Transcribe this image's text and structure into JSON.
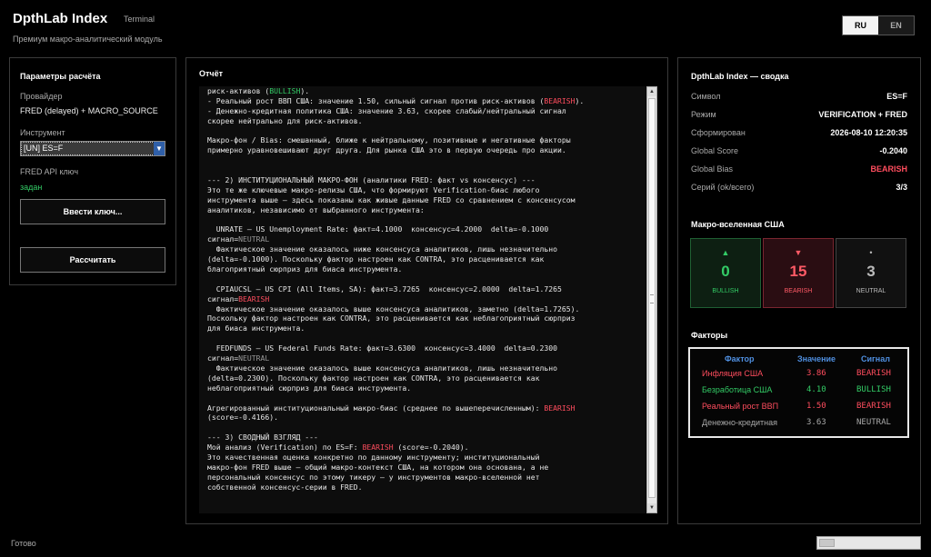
{
  "header": {
    "title": "DpthLab Index",
    "terminal": "Terminal",
    "subtitle": "Премиум макро-аналитический модуль"
  },
  "lang": {
    "ru": "RU",
    "en": "EN",
    "active": "RU"
  },
  "params": {
    "title": "Параметры расчёта",
    "provider_label": "Провайдер",
    "provider_value": "FRED (delayed) + MACRO_SOURCE",
    "instrument_label": "Инструмент",
    "instrument_value": "[UN] ES=F",
    "apikey_label": "FRED API ключ",
    "apikey_status": "задан",
    "enter_key_button": "Ввести ключ...",
    "calculate_button": "Рассчитать"
  },
  "report": {
    "title": "Отчёт",
    "lines": [
      [
        [
          "риск-активов (",
          ""
        ],
        [
          "BULLISH",
          "bull"
        ],
        [
          ").",
          ""
        ]
      ],
      [
        [
          "- Реальный рост ВВП США: значение 1.50, сильный сигнал против риск-активов (",
          ""
        ],
        [
          "BEARISH",
          "bear"
        ],
        [
          ").",
          ""
        ]
      ],
      [
        [
          "- Денежно-кредитная политика США: значение 3.63, скорее слабый/нейтральный сигнал",
          ""
        ]
      ],
      [
        [
          "скорее нейтрально для риск-активов.",
          ""
        ]
      ],
      [
        [
          "",
          ""
        ]
      ],
      [
        [
          "Макро-фон / Bias: смешанный, ближе к нейтральному, позитивные и негативные факторы",
          ""
        ]
      ],
      [
        [
          "примерно уравновешивают друг друга. Для рынка США это в первую очередь про акции.",
          ""
        ]
      ],
      [
        [
          "",
          ""
        ]
      ],
      [
        [
          "",
          ""
        ]
      ],
      [
        [
          "--- 2) ИНСТИТУЦИОНАЛЬНЫЙ МАКРО-ФОН (аналитики FRED: факт vs консенсус) ---",
          ""
        ]
      ],
      [
        [
          "Это те же ключевые макро-релизы США, что формируют Verification-биас любого",
          ""
        ]
      ],
      [
        [
          "инструмента выше — здесь показаны как живые данные FRED со сравнением с консенсусом",
          ""
        ]
      ],
      [
        [
          "аналитиков, независимо от выбранного инструмента:",
          ""
        ]
      ],
      [
        [
          "",
          ""
        ]
      ],
      [
        [
          "  UNRATE — US Unemployment Rate: факт=4.1000  консенсус=4.2000  delta=-0.1000",
          ""
        ]
      ],
      [
        [
          "сигнал=",
          ""
        ],
        [
          "NEUTRAL",
          "neu"
        ]
      ],
      [
        [
          "  Фактическое значение оказалось ниже консенсуса аналитиков, лишь незначительно",
          ""
        ]
      ],
      [
        [
          "(delta=-0.1000). Поскольку фактор настроен как CONTRA, это расценивается как",
          ""
        ]
      ],
      [
        [
          "благоприятный сюрприз для биаса инструмента.",
          ""
        ]
      ],
      [
        [
          "",
          ""
        ]
      ],
      [
        [
          "  CPIAUCSL — US CPI (All Items, SA): факт=3.7265  консенсус=2.0000  delta=1.7265",
          ""
        ]
      ],
      [
        [
          "сигнал=",
          ""
        ],
        [
          "BEARISH",
          "bear"
        ]
      ],
      [
        [
          "  Фактическое значение оказалось выше консенсуса аналитиков, заметно (delta=1.7265).",
          ""
        ]
      ],
      [
        [
          "Поскольку фактор настроен как CONTRA, это расценивается как неблагоприятный сюрприз",
          ""
        ]
      ],
      [
        [
          "для биаса инструмента.",
          ""
        ]
      ],
      [
        [
          "",
          ""
        ]
      ],
      [
        [
          "  FEDFUNDS — US Federal Funds Rate: факт=3.6300  консенсус=3.4000  delta=0.2300",
          ""
        ]
      ],
      [
        [
          "сигнал=",
          ""
        ],
        [
          "NEUTRAL",
          "neu"
        ]
      ],
      [
        [
          "  Фактическое значение оказалось выше консенсуса аналитиков, лишь незначительно",
          ""
        ]
      ],
      [
        [
          "(delta=0.2300). Поскольку фактор настроен как CONTRA, это расценивается как",
          ""
        ]
      ],
      [
        [
          "неблагоприятный сюрприз для биаса инструмента.",
          ""
        ]
      ],
      [
        [
          "",
          ""
        ]
      ],
      [
        [
          "Агрегированный институциональный макро-биас (среднее по вышеперечисленным): ",
          ""
        ],
        [
          "BEARISH",
          "bear"
        ]
      ],
      [
        [
          "(score=-0.4166).",
          ""
        ]
      ],
      [
        [
          "",
          ""
        ]
      ],
      [
        [
          "--- 3) СВОДНЫЙ ВЗГЛЯД ---",
          ""
        ]
      ],
      [
        [
          "Мой анализ (Verification) по ES=F: ",
          ""
        ],
        [
          "BEARISH",
          "bear"
        ],
        [
          " (score=-0.2040).",
          ""
        ]
      ],
      [
        [
          "Это качественная оценка конкретно по данному инструменту; институциональный",
          ""
        ]
      ],
      [
        [
          "макро-фон FRED выше — общий макро-контекст США, на котором она основана, а не",
          ""
        ]
      ],
      [
        [
          "персональный консенсус по этому тикеру — у инструментов макро-вселенной нет",
          ""
        ]
      ],
      [
        [
          "собственной консенсус-серии в FRED.",
          ""
        ]
      ]
    ]
  },
  "summary": {
    "title": "DpthLab Index — сводка",
    "rows": [
      {
        "k": "Символ",
        "v": "ES=F",
        "bear": false
      },
      {
        "k": "Режим",
        "v": "VERIFICATION + FRED",
        "bear": false
      },
      {
        "k": "Сформирован",
        "v": "2026-08-10 12:20:35",
        "bear": false
      },
      {
        "k": "Global Score",
        "v": "-0.2040",
        "bear": false
      },
      {
        "k": "Global Bias",
        "v": "BEARISH",
        "bear": true
      },
      {
        "k": "Серий (ok/всего)",
        "v": "3/3",
        "bear": false
      }
    ]
  },
  "universe": {
    "title": "Макро-вселенная США",
    "bullish": {
      "icon": "▲",
      "count": "0",
      "label": "BULLISH"
    },
    "bearish": {
      "icon": "▼",
      "count": "15",
      "label": "BEARISH"
    },
    "neutral": {
      "icon": "•",
      "count": "3",
      "label": "NEUTRAL"
    }
  },
  "factors": {
    "title": "Факторы",
    "headers": {
      "factor": "Фактор",
      "value": "Значение",
      "signal": "Сигнал"
    },
    "rows": [
      {
        "factor": "Инфляция США",
        "value": "3.86",
        "signal": "BEARISH",
        "color": "#ff4d5e"
      },
      {
        "factor": "Безработица США",
        "value": "4.10",
        "signal": "BULLISH",
        "color": "#33cc66"
      },
      {
        "factor": "Реальный рост ВВП",
        "value": "1.50",
        "signal": "BEARISH",
        "color": "#ff4d5e"
      },
      {
        "factor": "Денежно-кредитная",
        "value": "3.63",
        "signal": "NEUTRAL",
        "color": "#aaaaaa"
      }
    ]
  },
  "status": {
    "text": "Готово",
    "progress": 0.15
  },
  "colors": {
    "bull": "#33cc66",
    "bear": "#ff4d5e",
    "neutral": "#999999",
    "accent": "#4f8fe0"
  }
}
